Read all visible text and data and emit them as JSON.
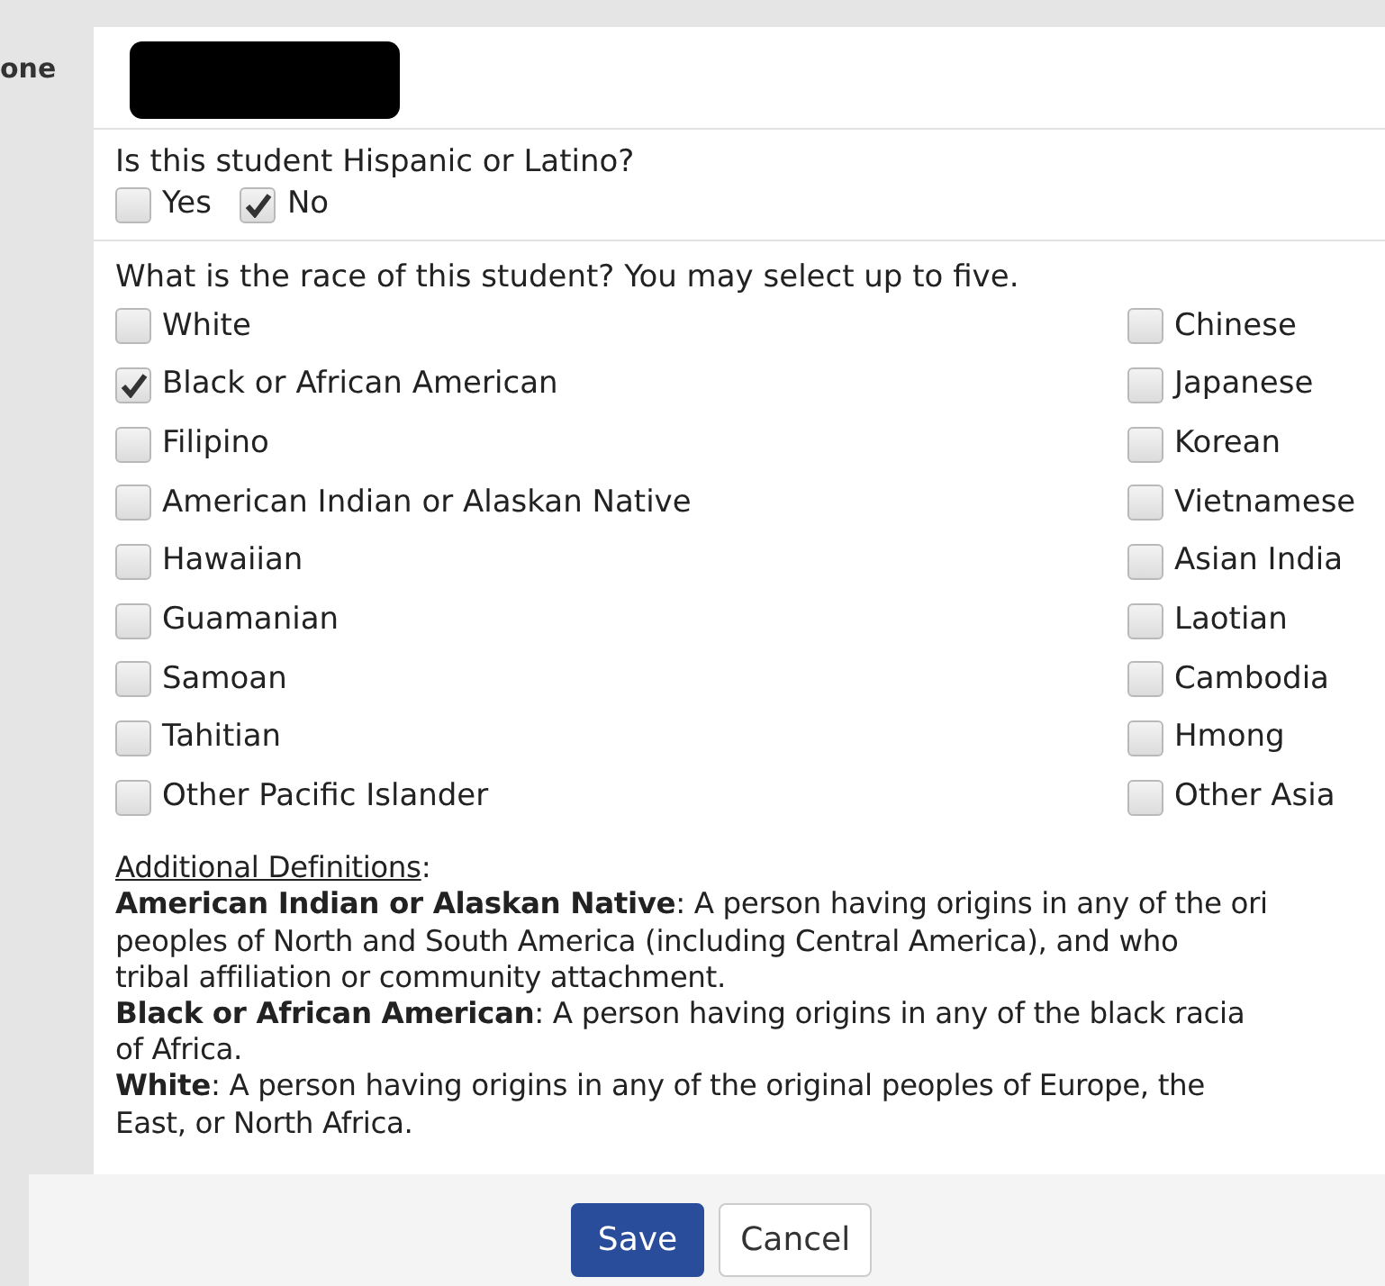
{
  "phone_field": {
    "label": "one",
    "redacted": true
  },
  "hispanic": {
    "question": "Is this student Hispanic or Latino?",
    "options": [
      {
        "label": "Yes",
        "checked": false
      },
      {
        "label": "No",
        "checked": true
      }
    ]
  },
  "race": {
    "question": "What is the race of this student? You may select up to five.",
    "options": [
      {
        "label": "White",
        "checked": false
      },
      {
        "label": "Chinese",
        "checked": false
      },
      {
        "label": "Black or African American",
        "checked": true
      },
      {
        "label": "Japanese",
        "checked": false
      },
      {
        "label": "Filipino",
        "checked": false
      },
      {
        "label": "Korean",
        "checked": false
      },
      {
        "label": "American Indian or Alaskan Native",
        "checked": false
      },
      {
        "label": "Vietnamese",
        "checked": false
      },
      {
        "label": "Hawaiian",
        "checked": false
      },
      {
        "label": "Asian India",
        "checked": false
      },
      {
        "label": "Guamanian",
        "checked": false
      },
      {
        "label": "Laotian",
        "checked": false
      },
      {
        "label": "Samoan",
        "checked": false
      },
      {
        "label": "Cambodia",
        "checked": false
      },
      {
        "label": "Tahitian",
        "checked": false
      },
      {
        "label": "Hmong",
        "checked": false
      },
      {
        "label": "Other Pacific Islander",
        "checked": false
      },
      {
        "label": "Other Asia",
        "checked": false
      }
    ]
  },
  "definitions": {
    "heading": "Additional Definitions",
    "heading_suffix": ":",
    "entries": [
      {
        "lines": [
          "**American Indian or Alaskan Native**: A person having origins in any of the ori",
          "peoples of North and South America (including Central America), and who",
          "tribal affiliation or community attachment."
        ]
      },
      {
        "lines": [
          "**Black or African American**: A person having origins in any of the black racia",
          "of Africa."
        ]
      },
      {
        "lines": [
          "**White**: A person having origins in any of the original peoples of Europe, the",
          "East, or North Africa."
        ]
      }
    ]
  },
  "buttons": [
    {
      "label": "Save",
      "kind": "primary"
    },
    {
      "label": "Cancel",
      "kind": "secondary"
    }
  ]
}
